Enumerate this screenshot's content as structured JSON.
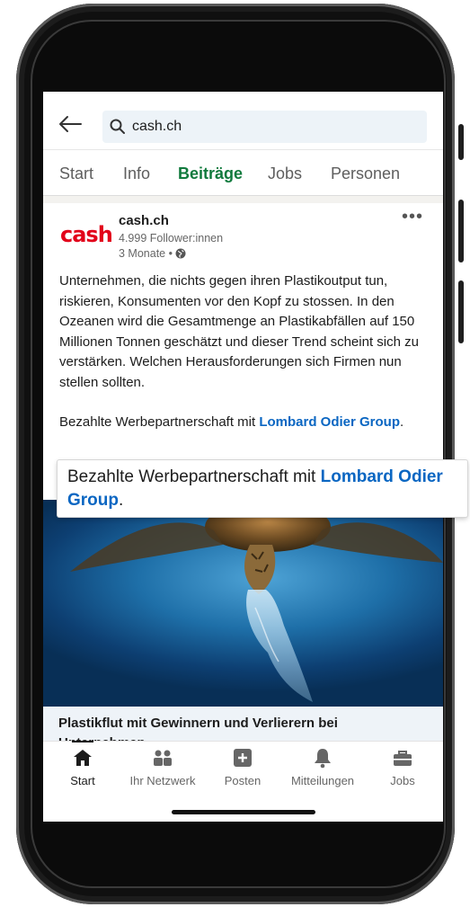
{
  "search": {
    "query": "cash.ch"
  },
  "tabs": [
    {
      "label": "Start"
    },
    {
      "label": "Info"
    },
    {
      "label": "Beiträge",
      "active": true
    },
    {
      "label": "Jobs"
    },
    {
      "label": "Personen"
    }
  ],
  "post": {
    "logo_text": "cash",
    "company": "cash.ch",
    "followers": "4.999 Follower:innen",
    "time": "3 Monate •",
    "body": "Unternehmen, die nichts gegen ihren Plastikoutput tun, riskieren, Konsumenten vor den Kopf zu stossen. In den Ozeanen wird die Gesamtmenge an Plastikabfällen auf 150 Millionen Tonnen geschätzt und dieser Trend scheint sich zu verstärken. Welchen Herausforderungen sich Firmen nun stellen sollten.",
    "sponsor_prefix": "Bezahlte Werbepartnerschaft mit ",
    "sponsor_link": "Lombard Odier Group",
    "sponsor_suffix": ".",
    "more": "•••",
    "image_alt": "turtle-eating-plastic-image",
    "caption": "Plastikflut mit Gewinnern und Verlierern bei",
    "caption_cont": "Unternehmen"
  },
  "callout": {
    "prefix": "Bezahlte Werbepartnerschaft mit ",
    "link": "Lombard Odier Group",
    "suffix": "."
  },
  "nav": [
    {
      "label": "Start",
      "icon": "home-icon",
      "active": true
    },
    {
      "label": "Ihr Netzwerk",
      "icon": "network-icon"
    },
    {
      "label": "Posten",
      "icon": "post-icon"
    },
    {
      "label": "Mitteilungen",
      "icon": "bell-icon"
    },
    {
      "label": "Jobs",
      "icon": "briefcase-icon"
    }
  ],
  "colors": {
    "accent": "#117a3d",
    "link": "#0a66c2",
    "brand_red": "#e2001a"
  }
}
